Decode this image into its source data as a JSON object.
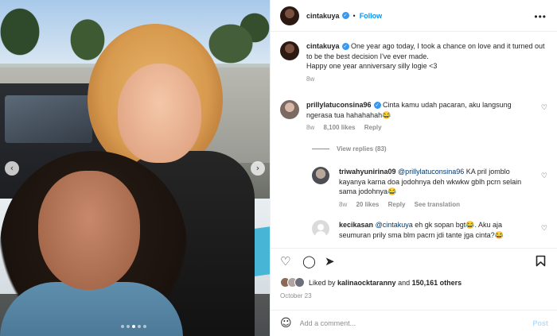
{
  "header": {
    "username": "cintakuya",
    "separator": "•",
    "follow_label": "Follow",
    "more_label": "•••",
    "verified_icon": "check-badge"
  },
  "caption": {
    "username": "cintakuya",
    "text": "One year ago today, I took a chance on love and it turned out to be the best decision I've ever made.",
    "text2": "Happy one year anniversary silly logie <3",
    "time": "8w"
  },
  "comments": [
    {
      "username": "prillylatuconsina96",
      "text": "Cinta kamu udah pacaran, aku langsung ngerasa tua hahahahah😂",
      "time": "8w",
      "likes": "8,100 likes",
      "reply": "Reply",
      "view_replies": "View replies (83)"
    },
    {
      "username": "triwahyunirina09",
      "mention": "@prillylatuconsina96",
      "text": "KA pril jomblo kayanya karna doa jodohnya deh wkwkw gblh pcrn selain sama jodohnya😂",
      "time": "8w",
      "likes": "20 likes",
      "reply": "Reply",
      "translate": "See translation"
    },
    {
      "username": "kecikasan",
      "mention": "@cintakuya",
      "text": "eh gk sopan bgt😂. Aku aja seumuran prily sma blm pacrn jdi tante jga cinta?😂"
    }
  ],
  "actions": {
    "icons": [
      "heart-icon",
      "comment-icon",
      "share-icon",
      "bookmark-icon"
    ]
  },
  "likes": {
    "prefix": "Liked by ",
    "first_liker": "kalinaocktaranny",
    "middle": " and ",
    "others": "150,161 others"
  },
  "date": "October 23",
  "add_comment": {
    "placeholder": "Add a comment...",
    "post_label": "Post"
  },
  "carousel": {
    "prev": "‹",
    "next": "›",
    "slide_count": 5,
    "active_slide": 3
  }
}
